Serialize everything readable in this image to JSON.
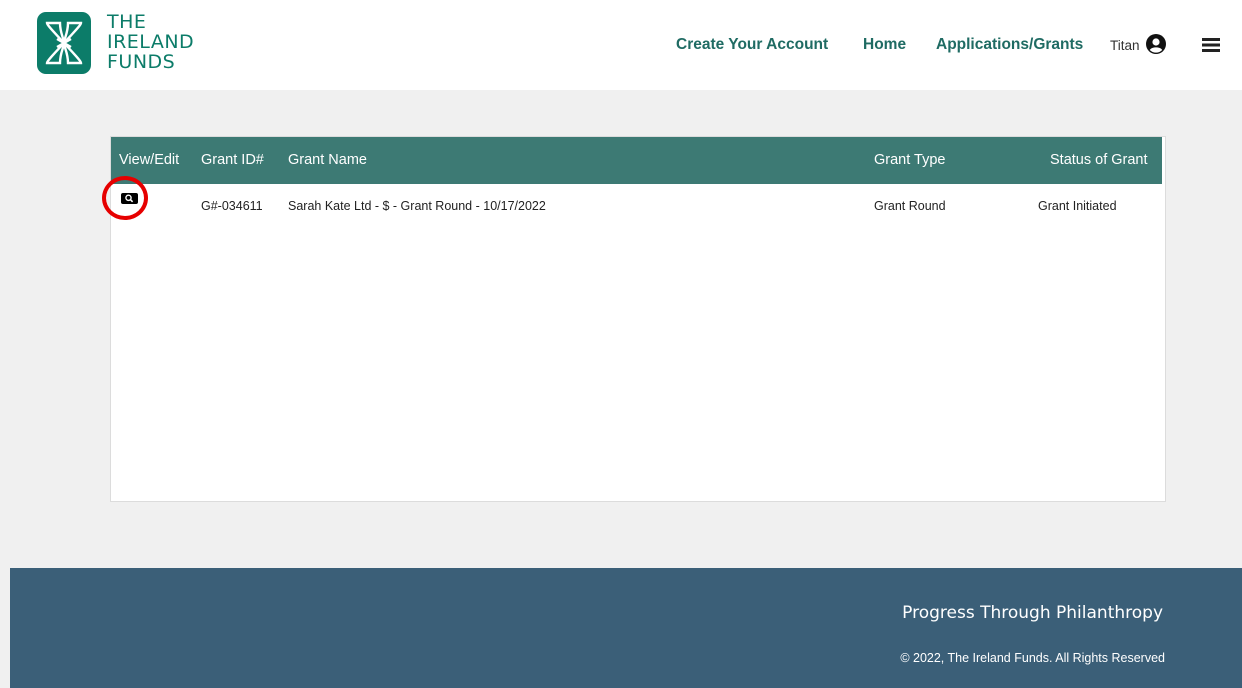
{
  "header": {
    "logo": {
      "line1": "THE",
      "line2": "IRELAND",
      "line3": "FUNDS",
      "icon": "shamrock-knot-icon"
    },
    "nav": [
      {
        "label": "Create Your Account"
      },
      {
        "label": "Home"
      },
      {
        "label": "Applications/Grants"
      }
    ],
    "user": {
      "name": "Titan",
      "icon": "user-circle-icon"
    },
    "menu_icon": "hamburger-menu-icon"
  },
  "table": {
    "columns": [
      "View/Edit",
      "Grant ID#",
      "Grant Name",
      "Grant Type",
      "Status of Grant"
    ],
    "rows": [
      {
        "view_icon": "magnifier-icon",
        "grant_id": "G#-034611",
        "grant_name": "Sarah Kate Ltd - $ - Grant Round - 10/17/2022",
        "grant_type": "Grant Round",
        "status": "Grant Initiated"
      }
    ]
  },
  "footer": {
    "tagline": "Progress Through Philanthropy",
    "copyright": "© 2022, The Ireland Funds. All Rights Reserved"
  },
  "colors": {
    "brand_green": "#0c7c69",
    "table_header": "#3d7a74",
    "footer_bg": "#3b5f78",
    "highlight": "#e60000"
  }
}
